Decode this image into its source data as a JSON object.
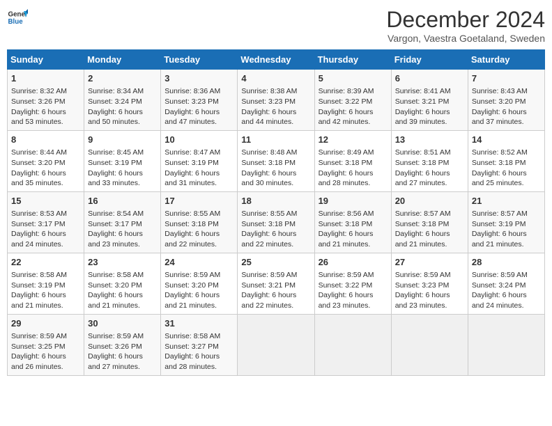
{
  "header": {
    "logo_line1": "General",
    "logo_line2": "Blue",
    "month": "December 2024",
    "location": "Vargon, Vaestra Goetaland, Sweden"
  },
  "weekdays": [
    "Sunday",
    "Monday",
    "Tuesday",
    "Wednesday",
    "Thursday",
    "Friday",
    "Saturday"
  ],
  "weeks": [
    [
      {
        "day": 1,
        "lines": [
          "Sunrise: 8:32 AM",
          "Sunset: 3:26 PM",
          "Daylight: 6 hours",
          "and 53 minutes."
        ]
      },
      {
        "day": 2,
        "lines": [
          "Sunrise: 8:34 AM",
          "Sunset: 3:24 PM",
          "Daylight: 6 hours",
          "and 50 minutes."
        ]
      },
      {
        "day": 3,
        "lines": [
          "Sunrise: 8:36 AM",
          "Sunset: 3:23 PM",
          "Daylight: 6 hours",
          "and 47 minutes."
        ]
      },
      {
        "day": 4,
        "lines": [
          "Sunrise: 8:38 AM",
          "Sunset: 3:23 PM",
          "Daylight: 6 hours",
          "and 44 minutes."
        ]
      },
      {
        "day": 5,
        "lines": [
          "Sunrise: 8:39 AM",
          "Sunset: 3:22 PM",
          "Daylight: 6 hours",
          "and 42 minutes."
        ]
      },
      {
        "day": 6,
        "lines": [
          "Sunrise: 8:41 AM",
          "Sunset: 3:21 PM",
          "Daylight: 6 hours",
          "and 39 minutes."
        ]
      },
      {
        "day": 7,
        "lines": [
          "Sunrise: 8:43 AM",
          "Sunset: 3:20 PM",
          "Daylight: 6 hours",
          "and 37 minutes."
        ]
      }
    ],
    [
      {
        "day": 8,
        "lines": [
          "Sunrise: 8:44 AM",
          "Sunset: 3:20 PM",
          "Daylight: 6 hours",
          "and 35 minutes."
        ]
      },
      {
        "day": 9,
        "lines": [
          "Sunrise: 8:45 AM",
          "Sunset: 3:19 PM",
          "Daylight: 6 hours",
          "and 33 minutes."
        ]
      },
      {
        "day": 10,
        "lines": [
          "Sunrise: 8:47 AM",
          "Sunset: 3:19 PM",
          "Daylight: 6 hours",
          "and 31 minutes."
        ]
      },
      {
        "day": 11,
        "lines": [
          "Sunrise: 8:48 AM",
          "Sunset: 3:18 PM",
          "Daylight: 6 hours",
          "and 30 minutes."
        ]
      },
      {
        "day": 12,
        "lines": [
          "Sunrise: 8:49 AM",
          "Sunset: 3:18 PM",
          "Daylight: 6 hours",
          "and 28 minutes."
        ]
      },
      {
        "day": 13,
        "lines": [
          "Sunrise: 8:51 AM",
          "Sunset: 3:18 PM",
          "Daylight: 6 hours",
          "and 27 minutes."
        ]
      },
      {
        "day": 14,
        "lines": [
          "Sunrise: 8:52 AM",
          "Sunset: 3:18 PM",
          "Daylight: 6 hours",
          "and 25 minutes."
        ]
      }
    ],
    [
      {
        "day": 15,
        "lines": [
          "Sunrise: 8:53 AM",
          "Sunset: 3:17 PM",
          "Daylight: 6 hours",
          "and 24 minutes."
        ]
      },
      {
        "day": 16,
        "lines": [
          "Sunrise: 8:54 AM",
          "Sunset: 3:17 PM",
          "Daylight: 6 hours",
          "and 23 minutes."
        ]
      },
      {
        "day": 17,
        "lines": [
          "Sunrise: 8:55 AM",
          "Sunset: 3:18 PM",
          "Daylight: 6 hours",
          "and 22 minutes."
        ]
      },
      {
        "day": 18,
        "lines": [
          "Sunrise: 8:55 AM",
          "Sunset: 3:18 PM",
          "Daylight: 6 hours",
          "and 22 minutes."
        ]
      },
      {
        "day": 19,
        "lines": [
          "Sunrise: 8:56 AM",
          "Sunset: 3:18 PM",
          "Daylight: 6 hours",
          "and 21 minutes."
        ]
      },
      {
        "day": 20,
        "lines": [
          "Sunrise: 8:57 AM",
          "Sunset: 3:18 PM",
          "Daylight: 6 hours",
          "and 21 minutes."
        ]
      },
      {
        "day": 21,
        "lines": [
          "Sunrise: 8:57 AM",
          "Sunset: 3:19 PM",
          "Daylight: 6 hours",
          "and 21 minutes."
        ]
      }
    ],
    [
      {
        "day": 22,
        "lines": [
          "Sunrise: 8:58 AM",
          "Sunset: 3:19 PM",
          "Daylight: 6 hours",
          "and 21 minutes."
        ]
      },
      {
        "day": 23,
        "lines": [
          "Sunrise: 8:58 AM",
          "Sunset: 3:20 PM",
          "Daylight: 6 hours",
          "and 21 minutes."
        ]
      },
      {
        "day": 24,
        "lines": [
          "Sunrise: 8:59 AM",
          "Sunset: 3:20 PM",
          "Daylight: 6 hours",
          "and 21 minutes."
        ]
      },
      {
        "day": 25,
        "lines": [
          "Sunrise: 8:59 AM",
          "Sunset: 3:21 PM",
          "Daylight: 6 hours",
          "and 22 minutes."
        ]
      },
      {
        "day": 26,
        "lines": [
          "Sunrise: 8:59 AM",
          "Sunset: 3:22 PM",
          "Daylight: 6 hours",
          "and 23 minutes."
        ]
      },
      {
        "day": 27,
        "lines": [
          "Sunrise: 8:59 AM",
          "Sunset: 3:23 PM",
          "Daylight: 6 hours",
          "and 23 minutes."
        ]
      },
      {
        "day": 28,
        "lines": [
          "Sunrise: 8:59 AM",
          "Sunset: 3:24 PM",
          "Daylight: 6 hours",
          "and 24 minutes."
        ]
      }
    ],
    [
      {
        "day": 29,
        "lines": [
          "Sunrise: 8:59 AM",
          "Sunset: 3:25 PM",
          "Daylight: 6 hours",
          "and 26 minutes."
        ]
      },
      {
        "day": 30,
        "lines": [
          "Sunrise: 8:59 AM",
          "Sunset: 3:26 PM",
          "Daylight: 6 hours",
          "and 27 minutes."
        ]
      },
      {
        "day": 31,
        "lines": [
          "Sunrise: 8:58 AM",
          "Sunset: 3:27 PM",
          "Daylight: 6 hours",
          "and 28 minutes."
        ]
      },
      null,
      null,
      null,
      null
    ]
  ]
}
